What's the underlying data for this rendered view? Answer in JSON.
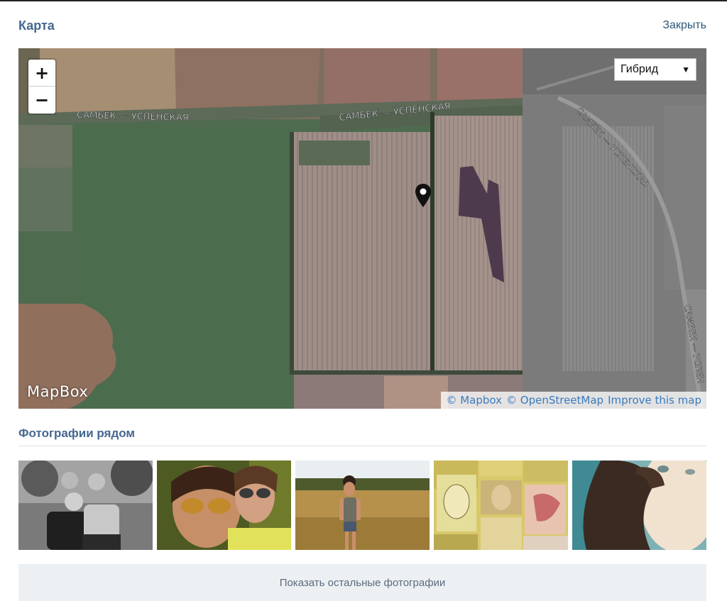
{
  "header": {
    "title": "Карта",
    "close_label": "Закрыть"
  },
  "map": {
    "zoom_in_label": "+",
    "zoom_out_label": "−",
    "layer_selected": "Гибрид",
    "road_labels": [
      "САМБЕК — УСПЕНСКАЯ",
      "САМБЕК — УСПЕНСКАЯ",
      "САМБЕК — УСПЕНСКАЯ",
      "САМБЕК — УСПЕН"
    ],
    "brand": "MapBox",
    "attribution": {
      "mapbox": "© Mapbox",
      "osm": "© OpenStreetMap",
      "improve": "Improve this map"
    },
    "pin_color": "#111111"
  },
  "nearby": {
    "title": "Фотографии рядом",
    "photo_count": 5,
    "more_label": "Показать остальные фотографии"
  },
  "colors": {
    "accent": "#45688e",
    "link": "#2b587a",
    "map_link": "#3a7bbf"
  }
}
